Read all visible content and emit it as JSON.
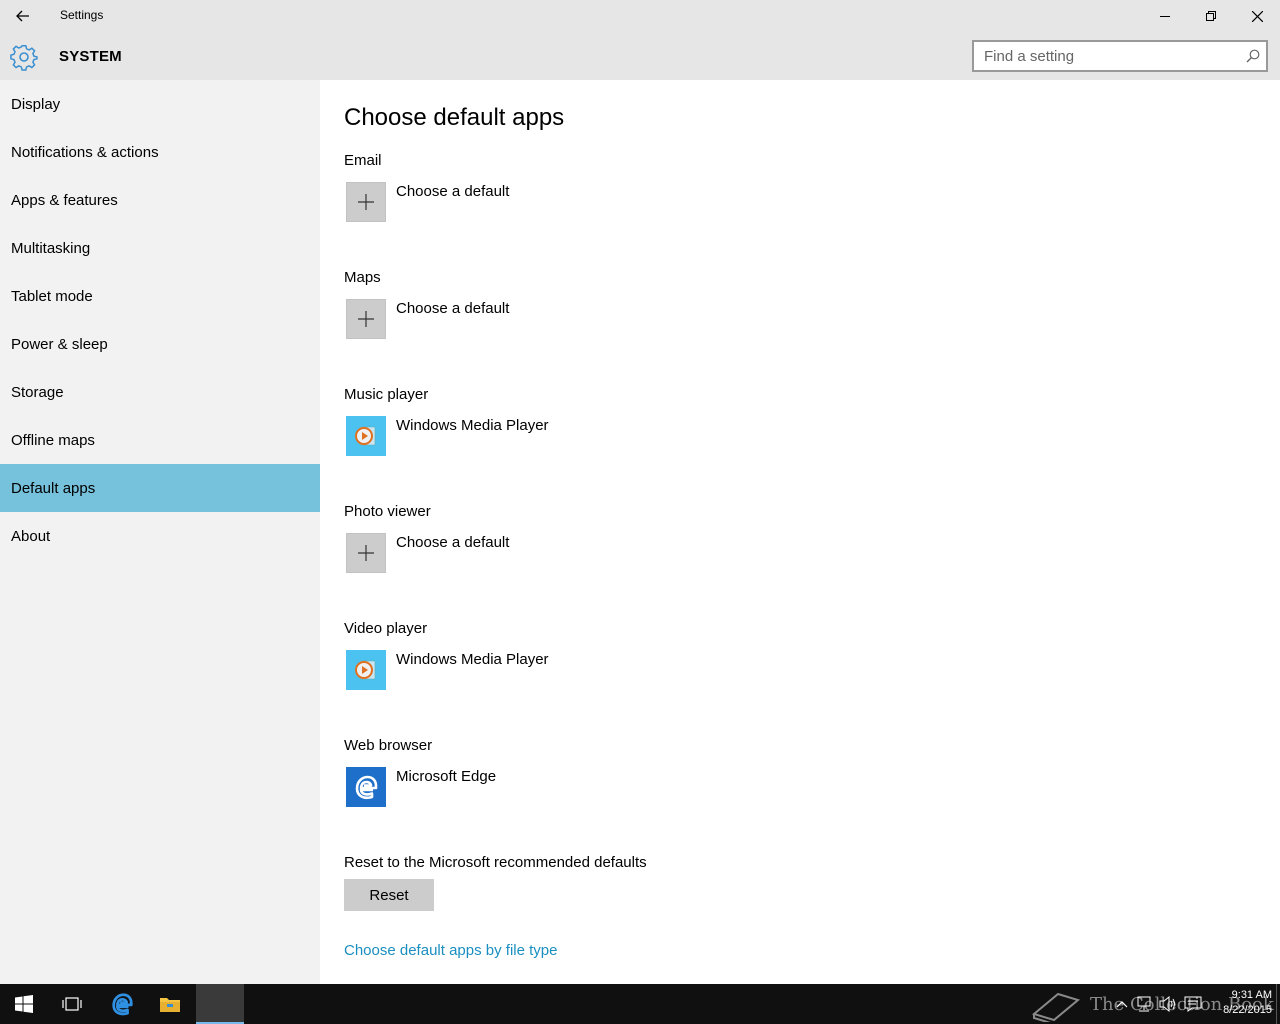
{
  "window": {
    "title": "Settings"
  },
  "header": {
    "section": "SYSTEM",
    "search_placeholder": "Find a setting"
  },
  "sidebar": {
    "items": [
      {
        "label": "Display"
      },
      {
        "label": "Notifications & actions"
      },
      {
        "label": "Apps & features"
      },
      {
        "label": "Multitasking"
      },
      {
        "label": "Tablet mode"
      },
      {
        "label": "Power & sleep"
      },
      {
        "label": "Storage"
      },
      {
        "label": "Offline maps"
      },
      {
        "label": "Default apps",
        "active": true
      },
      {
        "label": "About"
      }
    ]
  },
  "main": {
    "title": "Choose default apps",
    "groups": [
      {
        "label": "Email",
        "app": "Choose a default",
        "icon": "plus-icon"
      },
      {
        "label": "Maps",
        "app": "Choose a default",
        "icon": "plus-icon"
      },
      {
        "label": "Music player",
        "app": "Windows Media Player",
        "icon": "windows-media-player-icon"
      },
      {
        "label": "Photo viewer",
        "app": "Choose a default",
        "icon": "plus-icon"
      },
      {
        "label": "Video player",
        "app": "Windows Media Player",
        "icon": "windows-media-player-icon"
      },
      {
        "label": "Web browser",
        "app": "Microsoft Edge",
        "icon": "edge-icon"
      }
    ],
    "reset": {
      "label": "Reset to the Microsoft recommended defaults",
      "button": "Reset"
    },
    "file_type_link": "Choose default apps by file type"
  },
  "taskbar": {
    "watermark": "The Collection Book",
    "time": "9:31 AM",
    "date": "8/22/2015"
  },
  "colors": {
    "accent": "#76c2dc",
    "link": "#1a8fc0",
    "header_bg": "#e6e6e6",
    "sidebar_bg": "#f2f2f2",
    "taskbar_bg": "#101010"
  }
}
